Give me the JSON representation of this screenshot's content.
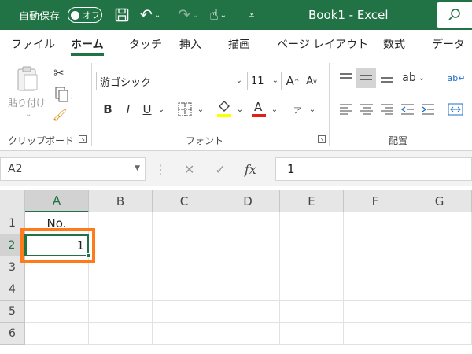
{
  "titlebar": {
    "autosave_label": "自動保存",
    "autosave_state": "オフ",
    "title": "Book1  -  Excel"
  },
  "tabs": [
    "ファイル",
    "ホーム",
    "タッチ",
    "挿入",
    "描画",
    "ページ レイアウト",
    "数式",
    "データ"
  ],
  "ribbon": {
    "clipboard": {
      "paste_label": "貼り付け",
      "group_label": "クリップボード"
    },
    "font": {
      "font_name": "游ゴシック",
      "font_size": "11",
      "bold": "B",
      "italic": "I",
      "underline": "U",
      "group_label": "フォント"
    },
    "alignment": {
      "group_label": "配置"
    }
  },
  "formula_bar": {
    "name_box": "A2",
    "fx": "fx",
    "value": "1"
  },
  "sheet": {
    "columns": [
      "A",
      "B",
      "C",
      "D",
      "E",
      "F",
      "G"
    ],
    "rows": [
      "1",
      "2",
      "3",
      "4",
      "5",
      "6"
    ],
    "cells": {
      "A1": "No.",
      "A2": "1"
    },
    "active_cell": "A2"
  },
  "colors": {
    "accent": "#217346",
    "highlight": "#ff7a1a",
    "font_color": "#e0201b",
    "fill_color": "#ffff00"
  }
}
